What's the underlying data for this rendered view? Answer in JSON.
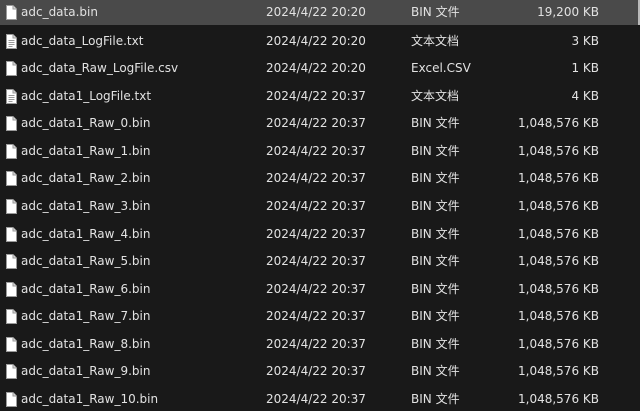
{
  "files": [
    {
      "name": "adc_data.bin",
      "date": "2024/4/22 20:20",
      "type": "BIN 文件",
      "size": "19,200 KB",
      "icon": "bin-file-icon",
      "selected": true
    },
    {
      "name": "adc_data_LogFile.txt",
      "date": "2024/4/22 20:20",
      "type": "文本文档",
      "size": "3 KB",
      "icon": "text-file-icon",
      "selected": false
    },
    {
      "name": "adc_data_Raw_LogFile.csv",
      "date": "2024/4/22 20:20",
      "type": "Excel.CSV",
      "size": "1 KB",
      "icon": "csv-file-icon",
      "selected": false
    },
    {
      "name": "adc_data1_LogFile.txt",
      "date": "2024/4/22 20:37",
      "type": "文本文档",
      "size": "4 KB",
      "icon": "text-file-icon",
      "selected": false
    },
    {
      "name": "adc_data1_Raw_0.bin",
      "date": "2024/4/22 20:37",
      "type": "BIN 文件",
      "size": "1,048,576 KB",
      "icon": "bin-file-icon",
      "selected": false
    },
    {
      "name": "adc_data1_Raw_1.bin",
      "date": "2024/4/22 20:37",
      "type": "BIN 文件",
      "size": "1,048,576 KB",
      "icon": "bin-file-icon",
      "selected": false
    },
    {
      "name": "adc_data1_Raw_2.bin",
      "date": "2024/4/22 20:37",
      "type": "BIN 文件",
      "size": "1,048,576 KB",
      "icon": "bin-file-icon",
      "selected": false
    },
    {
      "name": "adc_data1_Raw_3.bin",
      "date": "2024/4/22 20:37",
      "type": "BIN 文件",
      "size": "1,048,576 KB",
      "icon": "bin-file-icon",
      "selected": false
    },
    {
      "name": "adc_data1_Raw_4.bin",
      "date": "2024/4/22 20:37",
      "type": "BIN 文件",
      "size": "1,048,576 KB",
      "icon": "bin-file-icon",
      "selected": false
    },
    {
      "name": "adc_data1_Raw_5.bin",
      "date": "2024/4/22 20:37",
      "type": "BIN 文件",
      "size": "1,048,576 KB",
      "icon": "bin-file-icon",
      "selected": false
    },
    {
      "name": "adc_data1_Raw_6.bin",
      "date": "2024/4/22 20:37",
      "type": "BIN 文件",
      "size": "1,048,576 KB",
      "icon": "bin-file-icon",
      "selected": false
    },
    {
      "name": "adc_data1_Raw_7.bin",
      "date": "2024/4/22 20:37",
      "type": "BIN 文件",
      "size": "1,048,576 KB",
      "icon": "bin-file-icon",
      "selected": false
    },
    {
      "name": "adc_data1_Raw_8.bin",
      "date": "2024/4/22 20:37",
      "type": "BIN 文件",
      "size": "1,048,576 KB",
      "icon": "bin-file-icon",
      "selected": false
    },
    {
      "name": "adc_data1_Raw_9.bin",
      "date": "2024/4/22 20:37",
      "type": "BIN 文件",
      "size": "1,048,576 KB",
      "icon": "bin-file-icon",
      "selected": false
    },
    {
      "name": "adc_data1_Raw_10.bin",
      "date": "2024/4/22 20:37",
      "type": "BIN 文件",
      "size": "1,048,576 KB",
      "icon": "bin-file-icon",
      "selected": false
    }
  ]
}
